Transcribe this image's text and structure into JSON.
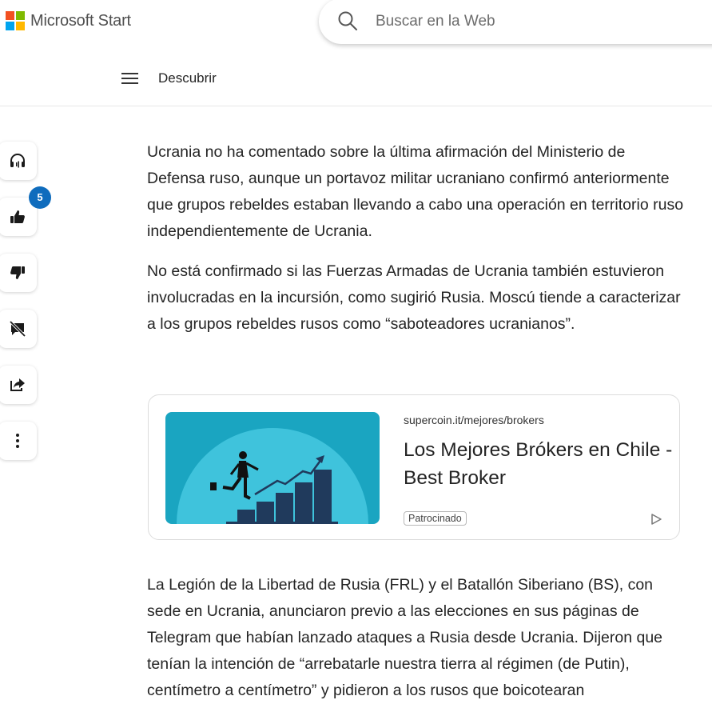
{
  "header": {
    "brand": "Microsoft Start",
    "logo_colors": [
      "#f25022",
      "#7fba00",
      "#00a4ef",
      "#ffb900"
    ],
    "search_placeholder": "Buscar en la Web"
  },
  "nav": {
    "label": "Descubrir"
  },
  "rail": {
    "like_count": "5",
    "badge_color": "#0f6cbd",
    "icons": [
      "headphones-icon",
      "thumbs-up-icon",
      "thumbs-down-icon",
      "comments-off-icon",
      "share-icon",
      "more-icon"
    ]
  },
  "article": {
    "paragraphs": [
      "Ucrania no ha comentado sobre la última afirmación del Ministerio de Defensa ruso, aunque un portavoz militar ucraniano confirmó anteriormente que grupos rebeldes estaban llevando a cabo una operación en territorio ruso independientemente de Ucrania.",
      "No está confirmado si las Fuerzas Armadas de Ucrania también estuvieron involucradas en la incursión, como sugirió Rusia. Moscú tiende a caracterizar a los grupos rebeldes rusos como “saboteadores ucranianos”."
    ],
    "paragraph_after_ad": "La Legión de la Libertad de Rusia (FRL) y el Batallón Siberiano (BS), con sede en Ucrania, anunciaron previo a las elecciones en sus páginas de Telegram que habían lanzado ataques a Rusia desde Ucrania. Dijeron que tenían la intención de “arrebatarle nuestra tierra al régimen (de Putin), centímetro a centímetro” y pidieron a los rusos que boicotearan"
  },
  "ad": {
    "source": "supercoin.it/mejores/brokers",
    "title": "Los Mejores Brókers en Chile - Best Broker",
    "sponsored_label": "Patrocinado",
    "image_bg": "#1aa5c1"
  }
}
